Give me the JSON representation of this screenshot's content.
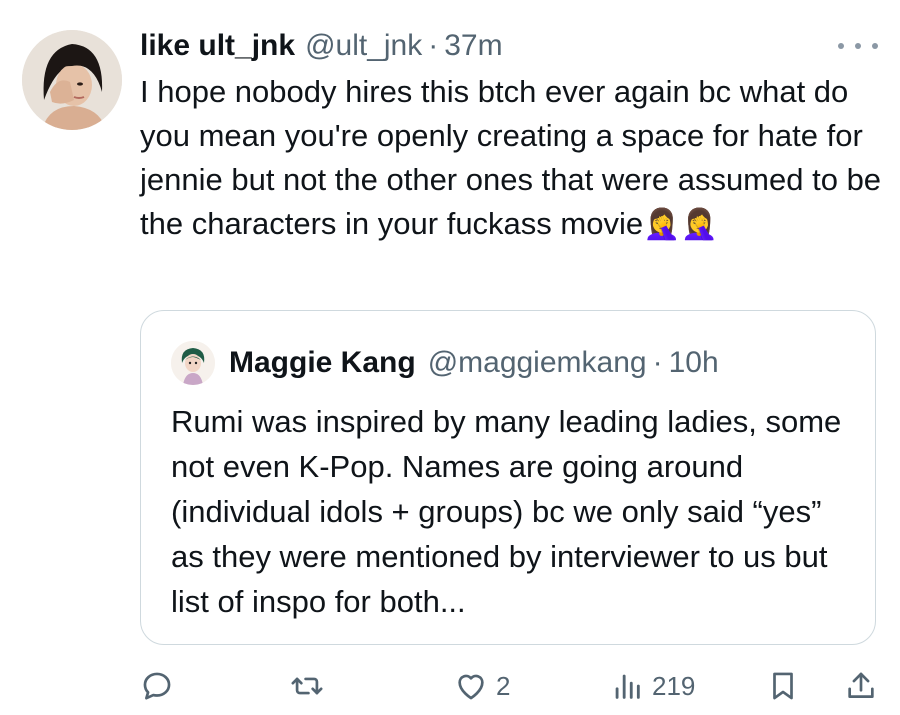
{
  "post": {
    "author": {
      "display_name": "like ult_jnk",
      "handle": "@ult_jnk",
      "separator": "·",
      "time": "37m"
    },
    "text": "I hope nobody hires this btch ever again bc what do you mean you're openly creating a space for hate for jennie but not the other ones that were assumed to be the characters in your fuckass movie",
    "emoji": "🤦‍♀️🤦‍♀️",
    "more_icon": "more-icon",
    "quote": {
      "display_name": "Maggie Kang",
      "handle": "@maggiemkang",
      "separator": "·",
      "time": "10h",
      "text": "Rumi was inspired by many leading ladies, some not even K-Pop. Names are going around (individual idols + groups) bc we only said “yes” as they were mentioned by interviewer to us but list of inspo for both..."
    },
    "actions": {
      "reply": {
        "icon": "reply-icon",
        "count": ""
      },
      "repost": {
        "icon": "repost-icon",
        "count": ""
      },
      "like": {
        "icon": "heart-icon",
        "count": "2"
      },
      "views": {
        "icon": "views-icon",
        "count": "219"
      },
      "bookmark": {
        "icon": "bookmark-icon",
        "count": ""
      },
      "share": {
        "icon": "share-icon",
        "count": ""
      }
    }
  },
  "colors": {
    "text_primary": "#0f1419",
    "text_secondary": "#536471",
    "border": "#cfd9de",
    "background": "#ffffff"
  }
}
